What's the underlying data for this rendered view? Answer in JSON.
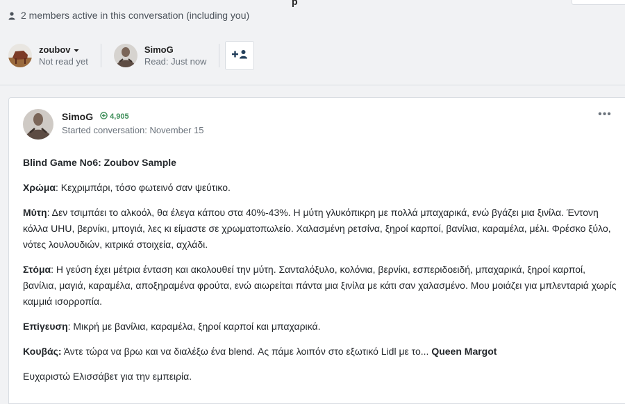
{
  "header": {
    "title_fragment": "p",
    "active_text": "2 members active in this conversation (including you)"
  },
  "participants": [
    {
      "name": "zoubov",
      "status": "Not read yet"
    },
    {
      "name": "SimoG",
      "status": "Read: Just now"
    }
  ],
  "post": {
    "author": "SimoG",
    "reputation": "4,905",
    "date_text": "Started conversation: November 15",
    "more_label": "•••",
    "title": "Blind Game No6: Zoubov Sample",
    "sections": [
      {
        "label": "Χρώμα",
        "text": ": Κεχριμπάρι, τόσο φωτεινό σαν ψεύτικο."
      },
      {
        "label": "Μύτη",
        "text": ": Δεν τσιμπάει το αλκοόλ, θα έλεγα κάπου στα 40%-43%. Η μύτη γλυκόπικρη με πολλά μπαχαρικά, ενώ βγάζει μια ξινίλα. Έντονη κόλλα UHU, βερνίκι, μπογιά, λες κι είμαστε σε χρωματοπωλείο. Χαλασμένη ρετσίνα, ξηροί καρποί, βανίλια, καραμέλα, μέλι. Φρέσκο ξύλο, νότες λουλουδιών, κιτρικά στοιχεία, αχλάδι."
      },
      {
        "label": "Στόμα",
        "text": ": Η γεύση έχει μέτρια ένταση και ακολουθεί την μύτη. Σανταλόξυλο, κολόνια, βερνίκι, εσπεριδοειδή, μπαχαρικά, ξηροί καρποί, βανίλια, μαγιά, καραμέλα, αποξηραμένα φρούτα, ενώ αιωρείται πάντα μια ξινίλα με κάτι σαν χαλασμένο. Μου μοιάζει για μπλενταριά χωρίς καμμιά ισορροπία."
      },
      {
        "label": "Επίγευση",
        "text": ": Μικρή με βανίλια, καραμέλα, ξηροί καρποί και μπαχαρικά."
      }
    ],
    "bucket": {
      "label": "Κουβάς:",
      "text": " Άντε τώρα να βρω και να διαλέξω ένα blend. Ας πάμε λοιπόν στο εξωτικό Lidl με το... ",
      "highlight": "Queen Margot"
    },
    "closing": "Ευχαριστώ Ελισσάβετ για την εμπειρία."
  },
  "colors": {
    "reputation_green": "#3f8f5a",
    "page_bg": "#f1f2f4",
    "card_bg": "#ffffff"
  }
}
